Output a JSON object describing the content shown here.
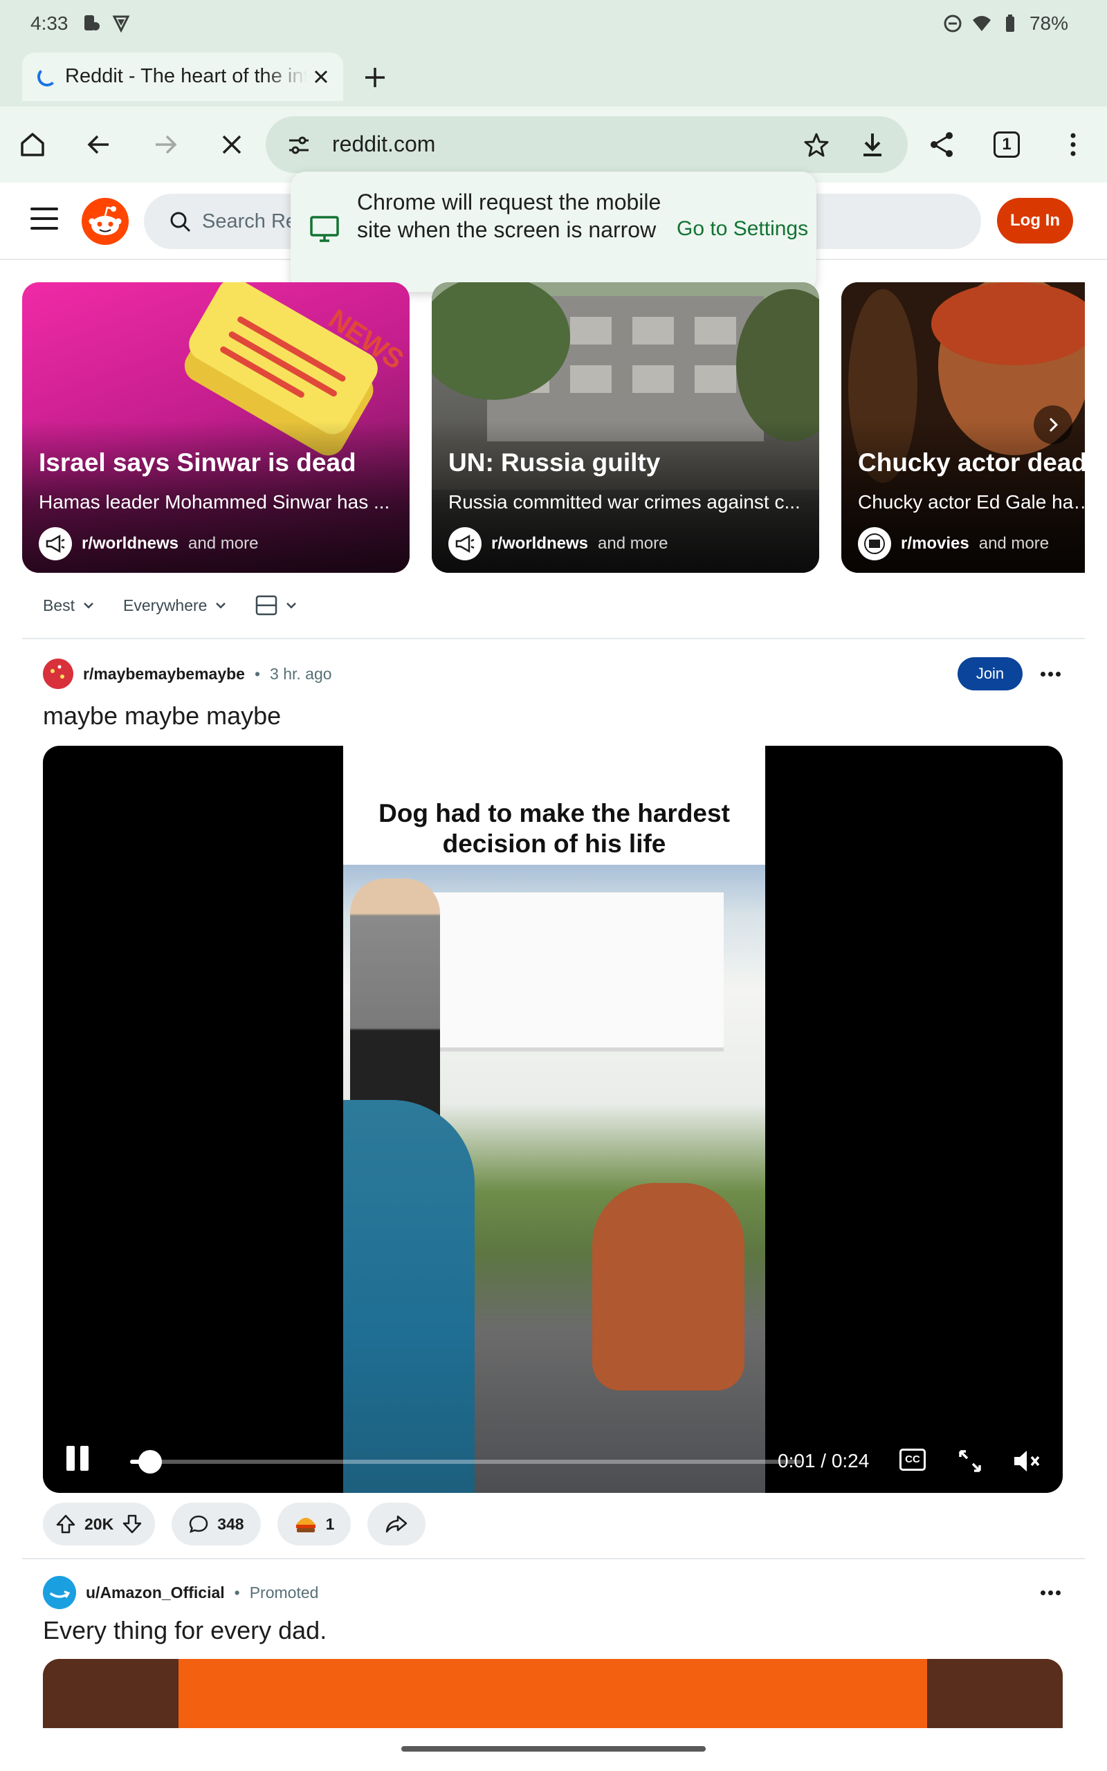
{
  "status_bar": {
    "time": "4:33",
    "battery": "78%"
  },
  "browser": {
    "tab_title": "Reddit - The heart of the internet",
    "url": "reddit.com",
    "tab_count": "1"
  },
  "chrome_popup": {
    "message": "Chrome will request the mobile site when the screen is narrow",
    "action": "Go to Settings"
  },
  "reddit_header": {
    "search_placeholder": "Search Reddit",
    "login_label": "Log In",
    "brand_color": "#d93900"
  },
  "news_cards": [
    {
      "title": "Israel says Sinwar is dead",
      "description": "Hamas leader Mohammed Sinwar has ...",
      "subreddit": "r/worldnews",
      "more": "and more",
      "image_text": "NEWS"
    },
    {
      "title": "UN: Russia guilty",
      "description": "Russia committed war crimes against c...",
      "subreddit": "r/worldnews",
      "more": "and more"
    },
    {
      "title": "Chucky actor dead a",
      "description": "Chucky actor Ed Gale has d",
      "subreddit": "r/movies",
      "more": "and more"
    }
  ],
  "sort_bar": {
    "sort": "Best",
    "scope": "Everywhere"
  },
  "post": {
    "subreddit": "r/maybemaybemaybe",
    "age": "3 hr. ago",
    "join_label": "Join",
    "title": "maybe maybe maybe",
    "video_caption": "Dog had to make the hardest decision of his life",
    "video_time": "0:01 / 0:24",
    "progress_fraction": 0.03,
    "cc_label": "CC",
    "upvotes": "20K",
    "comments": "348",
    "awards": "1"
  },
  "promoted": {
    "user": "u/Amazon_Official",
    "label": "Promoted",
    "title": "Every thing for every dad."
  }
}
